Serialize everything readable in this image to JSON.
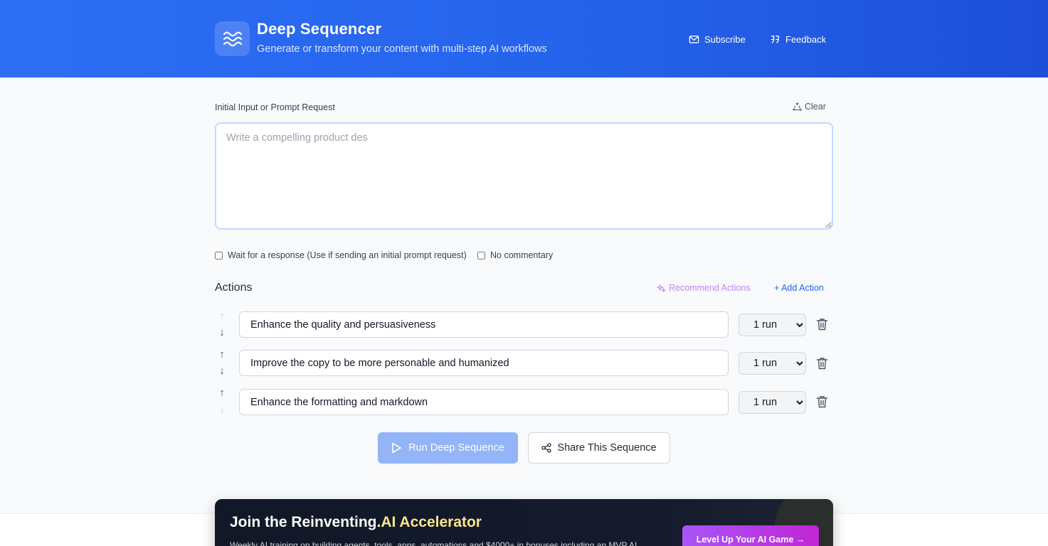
{
  "header": {
    "title": "Deep Sequencer",
    "subtitle": "Generate or transform your content with multi-step AI workflows",
    "subscribe_label": "Subscribe",
    "feedback_label": "Feedback",
    "logo_icon": "waves-icon"
  },
  "input": {
    "label": "Initial Input or Prompt Request",
    "clear_label": "Clear",
    "placeholder": "Write a compelling product des"
  },
  "options": {
    "wait_label": "Wait for a response (Use if sending an initial prompt request)",
    "wait_checked": false,
    "no_commentary_label": "No commentary",
    "no_commentary_checked": false
  },
  "actions": {
    "title": "Actions",
    "recommend_label": "Recommend Actions",
    "add_label": "+ Add Action",
    "items": [
      {
        "text": "Enhance the quality and persuasiveness",
        "runs": "1 run"
      },
      {
        "text": "Improve the copy to be more personable and humanized",
        "runs": "1 run"
      },
      {
        "text": "Enhance the formatting and markdown",
        "runs": "1 run"
      }
    ],
    "up_arrow": "↑",
    "down_arrow": "↓"
  },
  "buttons": {
    "run_label": "Run Deep Sequence",
    "share_label": "Share This Sequence"
  },
  "promo": {
    "title_prefix": "Join the Reinventing.",
    "title_accent": "AI Accelerator",
    "text": "Weekly AI training on building agents, tools, apps, automations and $4000+ in bonuses including an MVP AI",
    "button_label": "Level Up Your AI Game →"
  },
  "colors": {
    "header_blue": "#2563eb",
    "run_button": "#93b4f6",
    "recommend_purple": "#c084fc",
    "promo_accent": "#fde68a"
  }
}
